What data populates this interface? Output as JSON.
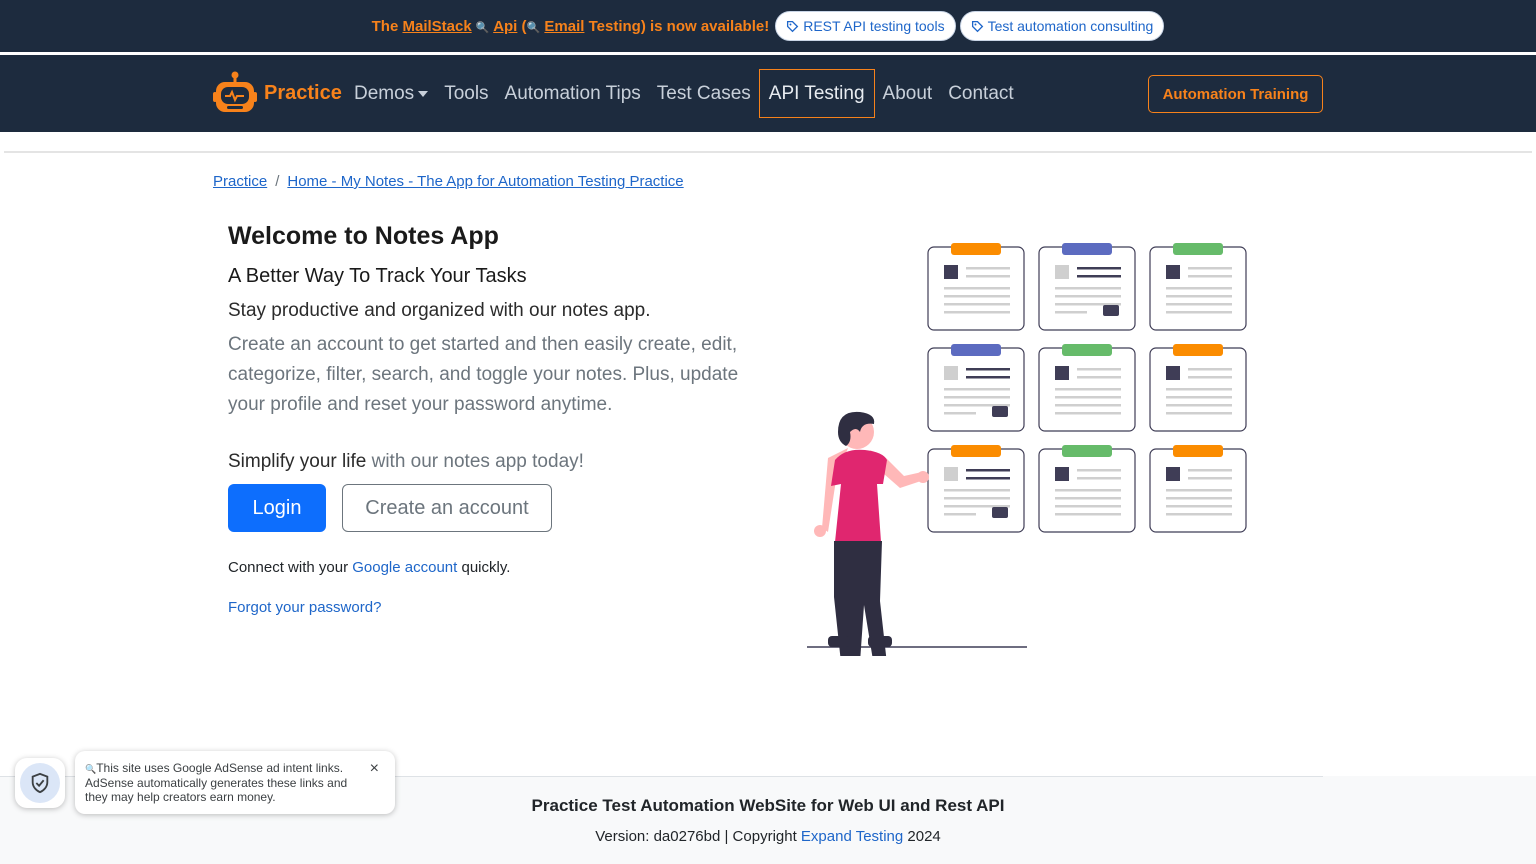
{
  "announcement": {
    "text_prefix": "The ",
    "link1": "MailStack",
    "icon1": "🔍",
    "link2": "Api",
    "text_mid": " (",
    "icon2": "🔍",
    "link3": "Email",
    "text_suffix": " Testing) is now available!",
    "pill1": "REST API testing tools",
    "pill2": "Test automation consulting"
  },
  "navbar": {
    "brand": "Practice",
    "links": [
      "Demos",
      "Tools",
      "Automation Tips",
      "Test Cases",
      "API Testing",
      "About",
      "Contact"
    ],
    "active": "API Testing",
    "training_button": "Automation Training"
  },
  "breadcrumb": {
    "root": "Practice",
    "separator": "/",
    "current": "Home - My Notes - The App for Automation Testing Practice"
  },
  "main": {
    "title": "Welcome to Notes App",
    "subtitle": "A Better Way To Track Your Tasks",
    "lead": "Stay productive and organized with our notes app.",
    "description": "Create an account to get started and then easily create, edit, categorize, filter, search, and toggle your notes. Plus, update your profile and reset your password anytime.",
    "simplify_strong": "Simplify your life",
    "simplify_rest": " with our notes app today!",
    "login_button": "Login",
    "create_button": "Create an account",
    "connect_prefix": "Connect with your ",
    "connect_link": "Google account",
    "connect_suffix": " quickly.",
    "forgot_link": "Forgot your password?"
  },
  "footer": {
    "title": "Practice Test Automation WebSite for Web UI and Rest API",
    "version_prefix": "Version: da0276bd | Copyright ",
    "company": "Expand Testing",
    "year": " 2024"
  },
  "ad_notice": {
    "icon": "🔍",
    "text": "This site uses Google AdSense ad intent links. AdSense automatically generates these links and they may help creators earn money.",
    "close": "×"
  },
  "colors": {
    "navy": "#1d2b3e",
    "accent_orange": "#f7821b",
    "primary_blue": "#0d6efd",
    "link_blue": "#1e66c9",
    "card_orange": "#fb8c00",
    "card_purple": "#5c6bc0",
    "card_green": "#66bb6a",
    "person_pink": "#e0266f",
    "dark": "#3f3d56"
  }
}
